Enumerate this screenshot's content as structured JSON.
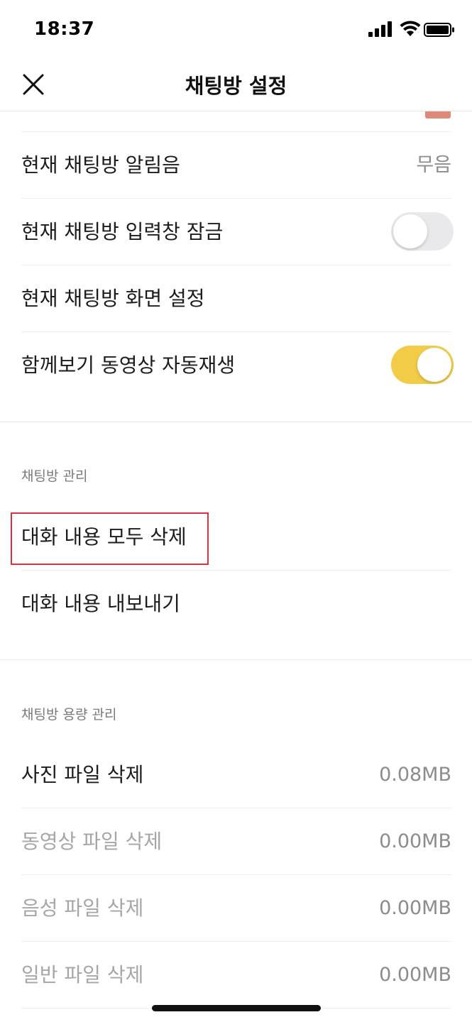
{
  "status_bar": {
    "time": "18:37"
  },
  "header": {
    "title": "채팅방 설정"
  },
  "settings": {
    "alert_sound": {
      "label": "현재 채팅방 알림음",
      "value": "무음"
    },
    "input_lock": {
      "label": "현재 채팅방 입력창 잠금",
      "enabled": false
    },
    "screen_settings": {
      "label": "현재 채팅방 화면 설정"
    },
    "autoplay": {
      "label": "함께보기 동영상 자동재생",
      "enabled": true
    }
  },
  "chat_management": {
    "header": "채팅방 관리",
    "delete_all": {
      "label": "대화 내용 모두 삭제"
    },
    "export": {
      "label": "대화 내용 내보내기"
    }
  },
  "storage_management": {
    "header": "채팅방 용량 관리",
    "items": [
      {
        "label": "사진 파일 삭제",
        "size": "0.08MB",
        "active": true
      },
      {
        "label": "동영상 파일 삭제",
        "size": "0.00MB",
        "active": false
      },
      {
        "label": "음성 파일 삭제",
        "size": "0.00MB",
        "active": false
      },
      {
        "label": "일반 파일 삭제",
        "size": "0.00MB",
        "active": false
      }
    ]
  },
  "colors": {
    "toggle_on": "#f2cb47",
    "highlight": "#d7333f"
  }
}
